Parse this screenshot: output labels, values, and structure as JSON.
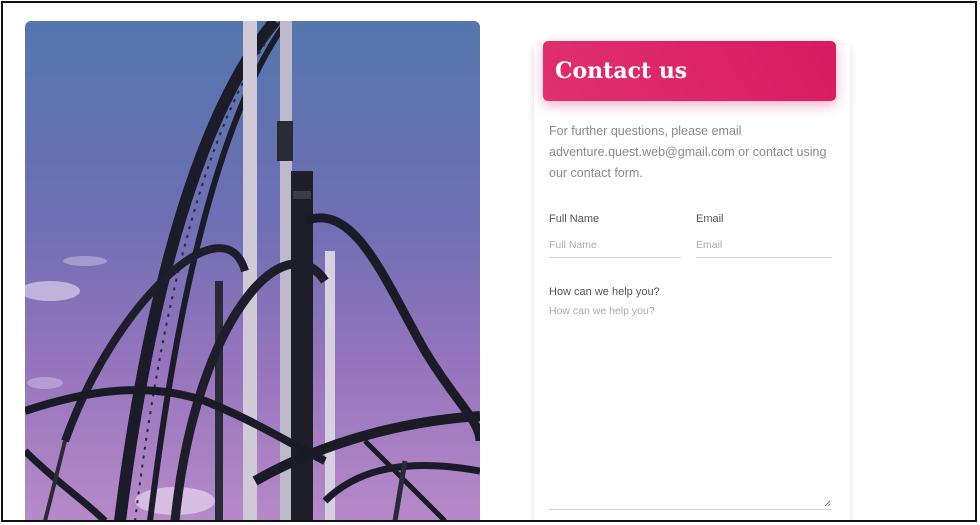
{
  "hero": {
    "image": "roller-coaster-photo"
  },
  "contact": {
    "title": "Contact us",
    "intro": "For further questions, please email adventure.quest.web@gmail.com or contact using our contact form.",
    "full_name": {
      "label": "Full Name",
      "placeholder": "Full Name"
    },
    "email": {
      "label": "Email",
      "placeholder": "Email"
    },
    "help": {
      "label": "How can we help you?",
      "placeholder": "How can we help you?"
    }
  },
  "colors": {
    "accent": "#d81b60",
    "sky_top": "#5476ad",
    "sky_bottom": "#b78ac8"
  }
}
